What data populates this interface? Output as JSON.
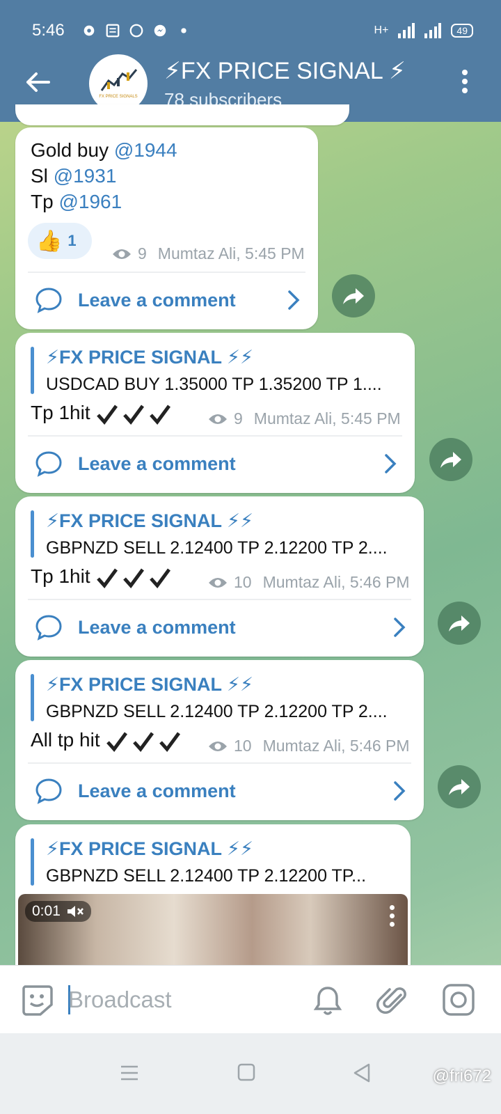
{
  "status_bar": {
    "time": "5:46",
    "network": "H+",
    "battery": "49"
  },
  "channel": {
    "title": "⚡FX PRICE SIGNAL ⚡",
    "subscribers": "78 subscribers",
    "avatar_caption": "FX PRICE SIGNALS"
  },
  "messages": [
    {
      "lines": [
        {
          "text": "Gold buy ",
          "mention": "@1944"
        },
        {
          "text": "Sl ",
          "mention": "@1931"
        },
        {
          "text": "Tp ",
          "mention": "@1961"
        }
      ],
      "reaction": {
        "emoji": "👍",
        "count": "1"
      },
      "views": "9",
      "author_time": "Mumtaz Ali, 5:45 PM",
      "comment_label": "Leave a comment"
    },
    {
      "reply_title": "⚡FX PRICE SIGNAL ⚡⚡",
      "reply_text": "USDCAD BUY 1.35000  TP 1.35200 TP 1....",
      "text": "Tp 1hit",
      "views": "9",
      "author_time": "Mumtaz Ali, 5:45 PM",
      "comment_label": "Leave a comment"
    },
    {
      "reply_title": "⚡FX PRICE SIGNAL ⚡⚡",
      "reply_text": "GBPNZD SELL 2.12400  TP 2.12200 TP 2....",
      "text": "Tp 1hit",
      "views": "10",
      "author_time": "Mumtaz Ali, 5:46 PM",
      "comment_label": "Leave a comment"
    },
    {
      "reply_title": "⚡FX PRICE SIGNAL ⚡⚡",
      "reply_text": "GBPNZD SELL 2.12400  TP 2.12200 TP 2....",
      "text": "All tp hit",
      "views": "10",
      "author_time": "Mumtaz Ali, 5:46 PM",
      "comment_label": "Leave a comment"
    },
    {
      "reply_title": "⚡FX PRICE SIGNAL ⚡⚡",
      "reply_text": "GBPNZD SELL 2.12400  TP 2.12200 TP...",
      "video_duration": "0:01"
    }
  ],
  "input": {
    "placeholder": "Broadcast"
  },
  "watermark": "@fri672",
  "colors": {
    "header": "#527da3",
    "accent": "#3a80bf",
    "bubble": "#ffffff"
  }
}
